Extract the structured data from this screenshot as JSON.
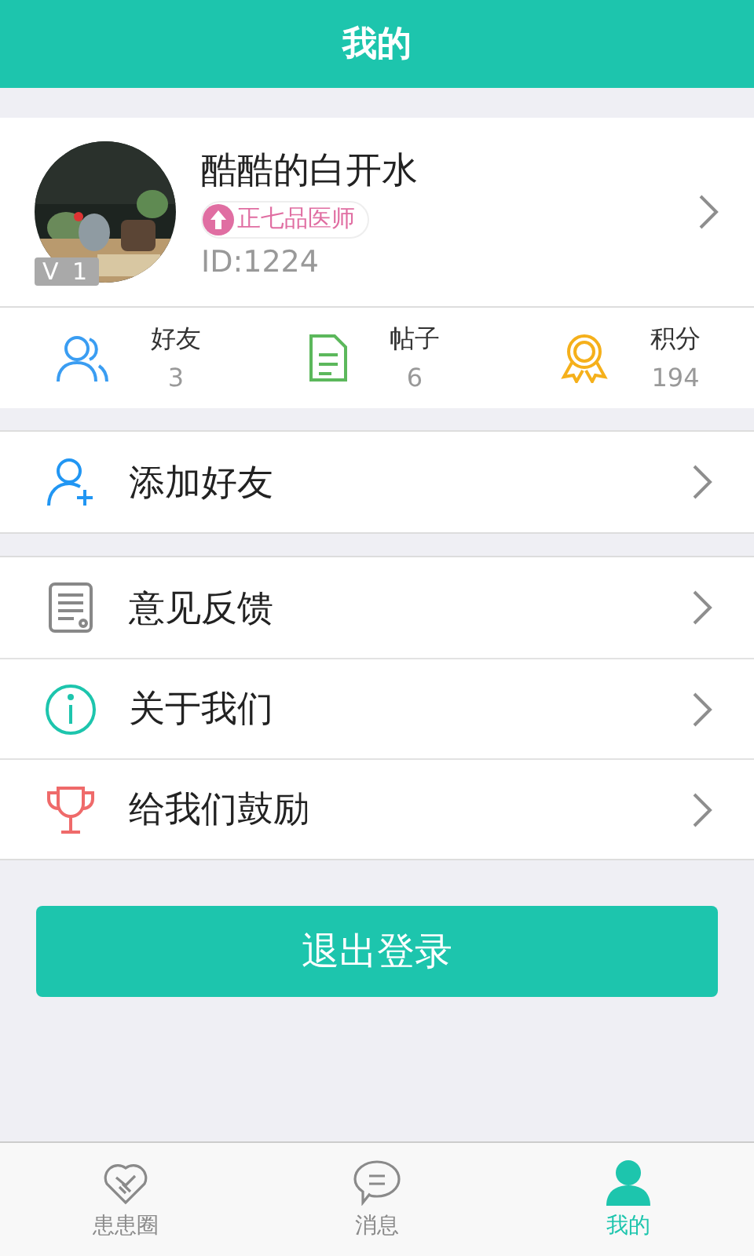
{
  "header": {
    "title": "我的"
  },
  "profile": {
    "name": "酷酷的白开水",
    "level_badge": "V 1",
    "rank_badge": "正七品医师",
    "id": "ID:1224"
  },
  "stats": [
    {
      "kind": "friends",
      "label": "好友",
      "value": "3"
    },
    {
      "kind": "posts",
      "label": "帖子",
      "value": "6"
    },
    {
      "kind": "points",
      "label": "积分",
      "value": "194"
    }
  ],
  "menu_groups": [
    [
      {
        "kind": "add-friend",
        "label": "添加好友"
      }
    ],
    [
      {
        "kind": "feedback",
        "label": "意见反馈"
      },
      {
        "kind": "about",
        "label": "关于我们"
      },
      {
        "kind": "encourage",
        "label": "给我们鼓励"
      }
    ]
  ],
  "logout_button": "退出登录",
  "tab_bar": [
    {
      "kind": "circle",
      "label": "患患圈",
      "selected": false
    },
    {
      "kind": "messages",
      "label": "消息",
      "selected": false
    },
    {
      "kind": "me",
      "label": "我的",
      "selected": true
    }
  ]
}
